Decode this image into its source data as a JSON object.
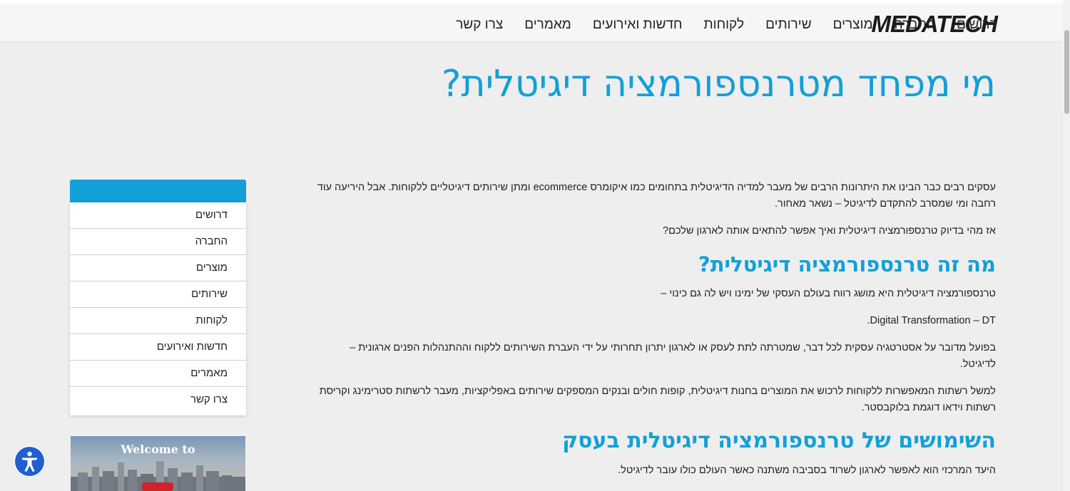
{
  "brand": {
    "logo_text": "MEDATECH"
  },
  "nav": {
    "items": [
      "דרושים",
      "החברה",
      "מוצרים",
      "שירותים",
      "לקוחות",
      "חדשות ואירועים",
      "מאמרים",
      "צרו קשר"
    ]
  },
  "page": {
    "title": "מי מפחד מטרנספורמציה דיגיטלית?"
  },
  "sidebar": {
    "items": [
      "דרושים",
      "החברה",
      "מוצרים",
      "שירותים",
      "לקוחות",
      "חדשות ואירועים",
      "מאמרים",
      "צרו קשר"
    ],
    "promo_text": "Welcome to"
  },
  "content": {
    "p1": "עסקים רבים כבר הבינו את היתרונות הרבים של מעבר למדיה הדיגיטלית בתחומים כמו איקומרס ecommerce ומתן שירותים דיגיטליים ללקוחות. אבל היריעה עוד רחבה ומי שמסרב להתקדם לדיגיטל – נשאר מאחור.",
    "p2": "אז מהי בדיוק טרנספורמציה דיגיטלית ואיך אפשר להתאים אותה לארגון שלכם?",
    "h2_1": "מה זה טרנספורמציה דיגיטלית?",
    "p3": "טרנספורמציה דיגיטלית היא מושג רווח בעולם העסקי של ימינו ויש לה גם כינוי –",
    "p4": "Digital Transformation –  DT.",
    "p5": "בפועל מדובר על אסטרטגיה עסקית לכל דבר, שמטרתה לתת לעסק או לארגון יתרון תחרותי על ידי העברת השירותים ללקוח וההתנהלות הפנים ארגונית – לדיגיטל.",
    "p6": "למשל רשתות המאפשרות ללקוחות לרכוש את המוצרים בחנות דיגיטלית, קופות חולים ובנקים המספקים שירותים באפליקציות, מעבר לרשתות סטרימינג וקריסת רשתות וידאו דוגמת בלוקבסטר.",
    "h2_2": "השימושים של טרנספורמציה דיגיטלית בעסק",
    "p7": "היעד המרכזי הוא לאפשר לארגון לשרוד בסביבה משתנה כאשר העולם כולו עובר לדיגיטל."
  },
  "accessibility": {
    "icon": "accessibility-icon"
  },
  "colors": {
    "accent": "#12a0d7",
    "access_button": "#1f5fd1",
    "background": "#eeeeee"
  }
}
